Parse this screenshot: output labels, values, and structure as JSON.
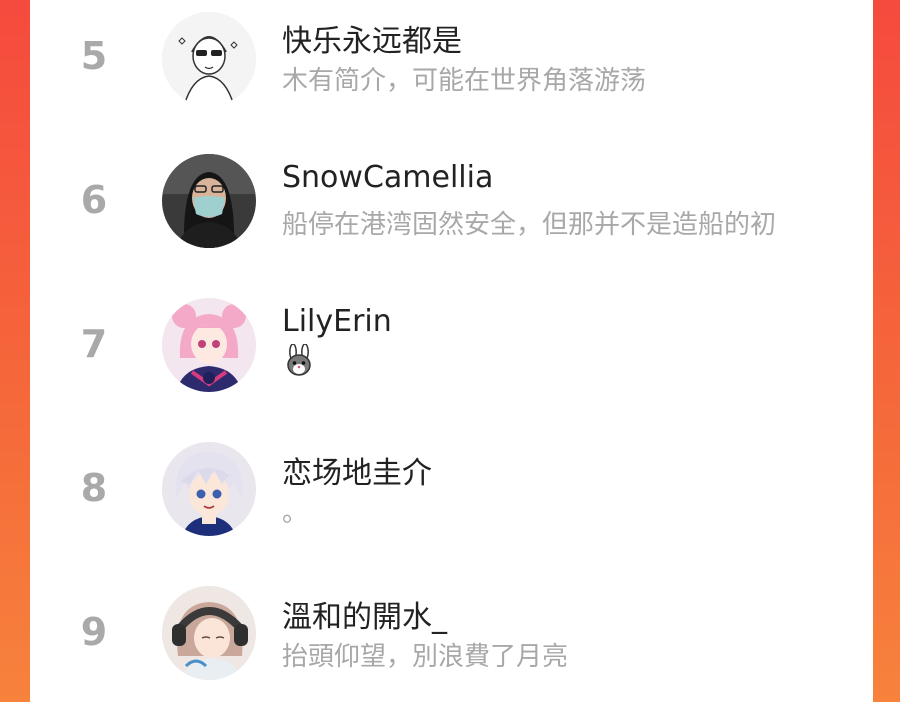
{
  "leaderboard": {
    "entries": [
      {
        "rank": "5",
        "name": "快乐永远都是",
        "bio": "木有简介，可能在世界角落游荡",
        "avatar_icon": "sketch-sunglasses-avatar"
      },
      {
        "rank": "6",
        "name": "SnowCamellia",
        "bio": "船停在港湾固然安全，但那并不是造船的初",
        "avatar_icon": "masked-girl-photo-avatar"
      },
      {
        "rank": "7",
        "name": "LilyErin",
        "bio": "🐰",
        "avatar_icon": "anime-pink-hair-avatar"
      },
      {
        "rank": "8",
        "name": "恋场地圭介",
        "bio": "。",
        "avatar_icon": "anime-white-hair-avatar"
      },
      {
        "rank": "9",
        "name": "溫和的開水_",
        "bio": "抬頭仰望，別浪費了月亮",
        "avatar_icon": "anime-headphones-avatar"
      }
    ]
  },
  "colors": {
    "background_gradient_start": "#f54a3e",
    "background_gradient_end": "#f7823c",
    "panel": "#ffffff",
    "rank_text": "#a9a9a9",
    "name_text": "#222222",
    "bio_text": "#a8a8a8"
  }
}
